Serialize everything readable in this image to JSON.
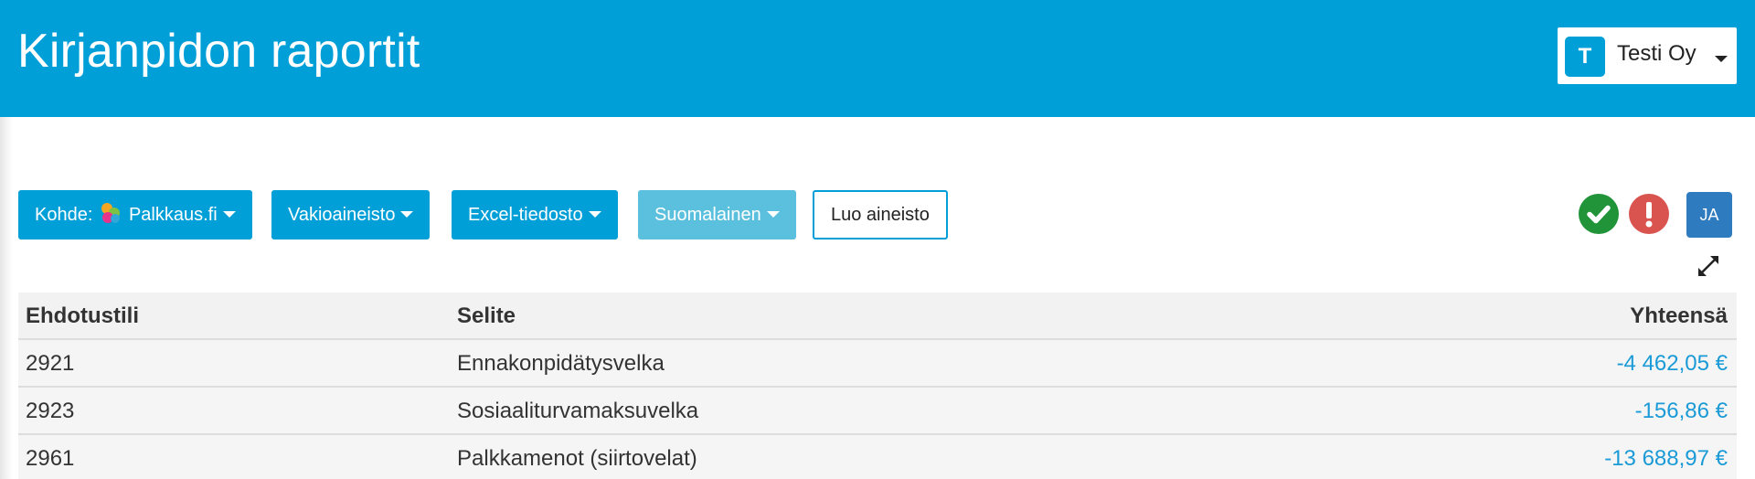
{
  "header": {
    "title": "Kirjanpidon raportit",
    "company": {
      "avatar_letter": "T",
      "name": "Testi Oy"
    }
  },
  "toolbar": {
    "target_prefix": "Kohde:",
    "target_value": "Palkkaus.fi",
    "standard_material": "Vakioaineisto",
    "file_format": "Excel-tiedosto",
    "language": "Suomalainen",
    "create": "Luo aineisto"
  },
  "status": {
    "ok_icon": "check-circle-icon",
    "error_icon": "exclamation-circle-icon"
  },
  "user": {
    "initials": "JA"
  },
  "table": {
    "headers": {
      "account": "Ehdotustili",
      "description": "Selite",
      "total": "Yhteensä"
    },
    "rows": [
      {
        "account": "2921",
        "description": "Ennakonpidätysvelka",
        "total": "-4 462,05 €"
      },
      {
        "account": "2923",
        "description": "Sosiaaliturvamaksuvelka",
        "total": "-156,86 €"
      },
      {
        "account": "2961",
        "description": "Palkkamenot (siirtovelat)",
        "total": "-13 688,97 €"
      }
    ]
  },
  "colors": {
    "brand": "#009fd8",
    "success": "#21943a",
    "danger": "#d9534f",
    "disabled_button": "#5bc0de",
    "user_badge": "#2f7bbf",
    "amount_text": "#1a9ad6"
  }
}
